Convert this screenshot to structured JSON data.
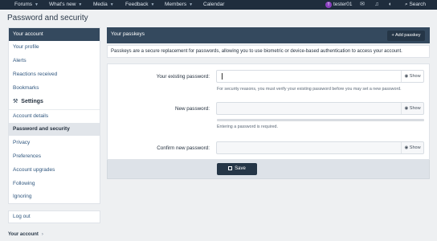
{
  "nav": {
    "items": [
      "Forums",
      "What's new",
      "Media",
      "Feedback",
      "Members",
      "Calendar"
    ],
    "user": "tester01",
    "avatar_letter": "T",
    "search": "Search"
  },
  "page_title": "Password and security",
  "sidebar": {
    "header": "Your account",
    "items": [
      "Your profile",
      "Alerts",
      "Reactions received",
      "Bookmarks"
    ],
    "settings_label": "Settings",
    "settings_items": [
      "Account details",
      "Password and security",
      "Privacy",
      "Preferences",
      "Account upgrades",
      "Following",
      "Ignoring"
    ],
    "active": "Password and security",
    "logout": "Log out"
  },
  "footer_crumb": "Your account",
  "passkeys": {
    "title": "Your passkeys",
    "add_button": "+ Add passkey",
    "info": "Passkeys are a secure replacement for passwords, allowing you to use biometric or device-based authentication to access your account."
  },
  "form": {
    "existing_label": "Your existing password:",
    "existing_hint": "For security reasons, you must verify your existing password before you may set a new password.",
    "new_label": "New password:",
    "new_hint": "Entering a password is required.",
    "confirm_label": "Confirm new password:",
    "show_label": "Show",
    "save_label": "Save"
  },
  "colors": {
    "nav_bg": "#1f2d3d",
    "block_header": "#34495e",
    "button": "#253647",
    "link": "#2f567e",
    "active_item": "#e1e5ea",
    "avatar": "#8a3fbf"
  }
}
